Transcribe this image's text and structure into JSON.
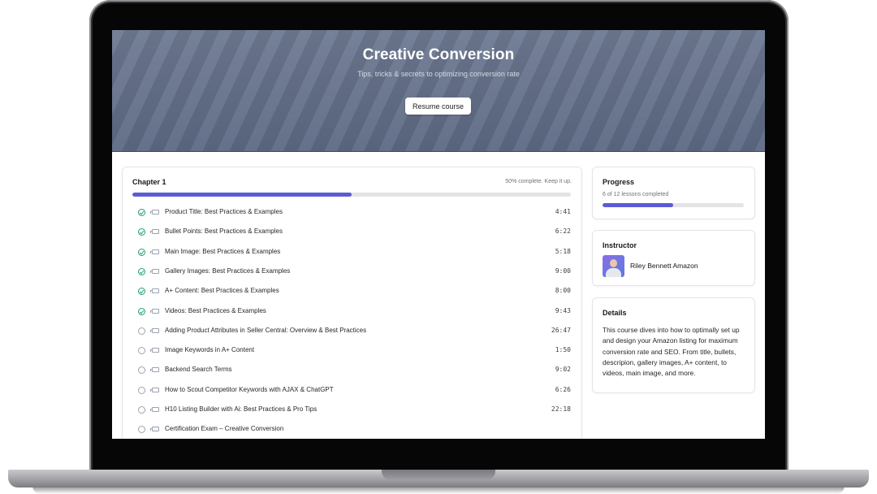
{
  "hero": {
    "title": "Creative Conversion",
    "subtitle": "Tips, tricks & secrets to optimizing conversion rate",
    "resume_label": "Resume course"
  },
  "chapter": {
    "title": "Chapter 1",
    "progress_text": "50% complete. Keep it up.",
    "progress_fraction": 0.5,
    "lessons": [
      {
        "title": "Product Title: Best Practices & Examples",
        "duration": "4:41",
        "completed": true,
        "type": "video-icon"
      },
      {
        "title": "Bullet Points: Best Practices & Examples",
        "duration": "6:22",
        "completed": true,
        "type": "video-icon"
      },
      {
        "title": "Main Image: Best Practices & Examples",
        "duration": "5:18",
        "completed": true,
        "type": "video-icon"
      },
      {
        "title": "Gallery Images: Best Practices & Examples",
        "duration": "9:00",
        "completed": true,
        "type": "video-icon"
      },
      {
        "title": "A+ Content: Best Practices & Examples",
        "duration": "8:00",
        "completed": true,
        "type": "video-icon"
      },
      {
        "title": "Videos: Best Practices & Examples",
        "duration": "9:43",
        "completed": true,
        "type": "video-icon"
      },
      {
        "title": "Adding Product Attributes in Seller Central: Overview & Best Practices",
        "duration": "26:47",
        "completed": false,
        "type": "video-icon"
      },
      {
        "title": "Image Keywords in A+ Content",
        "duration": "1:50",
        "completed": false,
        "type": "video-icon"
      },
      {
        "title": "Backend Search Terms",
        "duration": "9:02",
        "completed": false,
        "type": "video-icon"
      },
      {
        "title": "How to Scout Competitor Keywords with AJAX & ChatGPT",
        "duration": "6:26",
        "completed": false,
        "type": "video-icon"
      },
      {
        "title": "H10 Listing Builder with Ai: Best Practices & Pro Tips",
        "duration": "22:18",
        "completed": false,
        "type": "video-icon"
      },
      {
        "title": "Certification Exam – Creative Conversion",
        "duration": "",
        "completed": false,
        "type": "exam-icon"
      }
    ]
  },
  "progress": {
    "heading": "Progress",
    "summary": "6 of 12 lessons completed",
    "fraction": 0.5
  },
  "instructor": {
    "heading": "Instructor",
    "name": "Riley Bennett Amazon"
  },
  "details": {
    "heading": "Details",
    "text": "This course dives into how to optimally set up and design your Amazon listing for maximum conversion rate and SEO. From title, bullets, descripion, gallery images, A+ content, to videos, main image, and more."
  },
  "colors": {
    "accent": "#5b5bd6",
    "complete": "#22a06b",
    "hero": "#66728c"
  }
}
